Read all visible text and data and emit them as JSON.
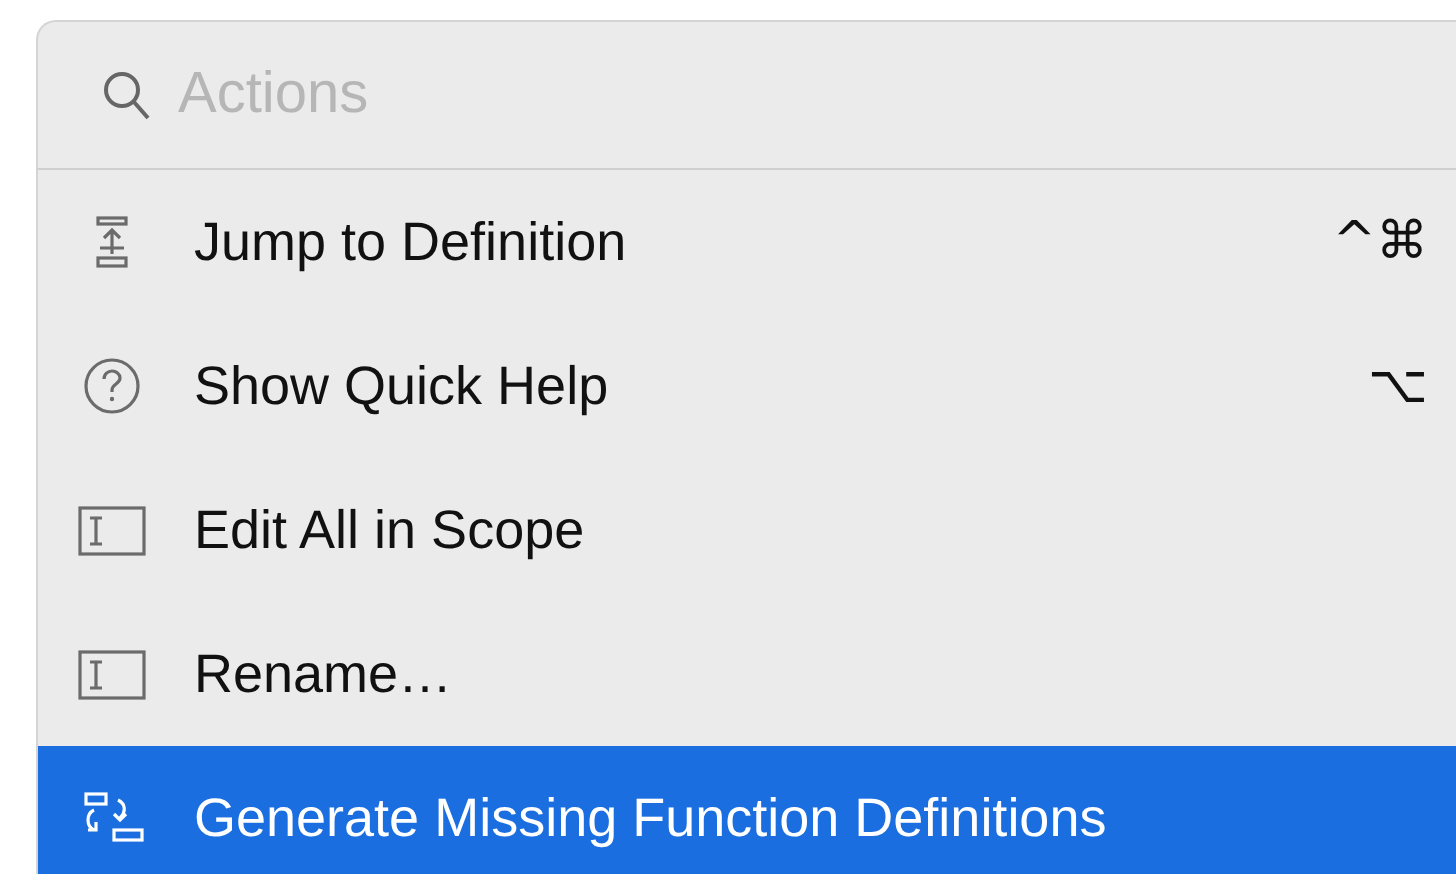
{
  "search": {
    "placeholder": "Actions"
  },
  "items": [
    {
      "kind": "jump",
      "label": "Jump to Definition",
      "shortcut": "^⌘",
      "selected": false
    },
    {
      "kind": "help",
      "label": "Show Quick Help",
      "shortcut": "⌥",
      "selected": false
    },
    {
      "kind": "field",
      "label": "Edit All in Scope",
      "selected": false
    },
    {
      "kind": "field",
      "label": "Rename…",
      "selected": false
    },
    {
      "kind": "generate",
      "label": "Generate Missing Function Definitions",
      "selected": true
    }
  ]
}
